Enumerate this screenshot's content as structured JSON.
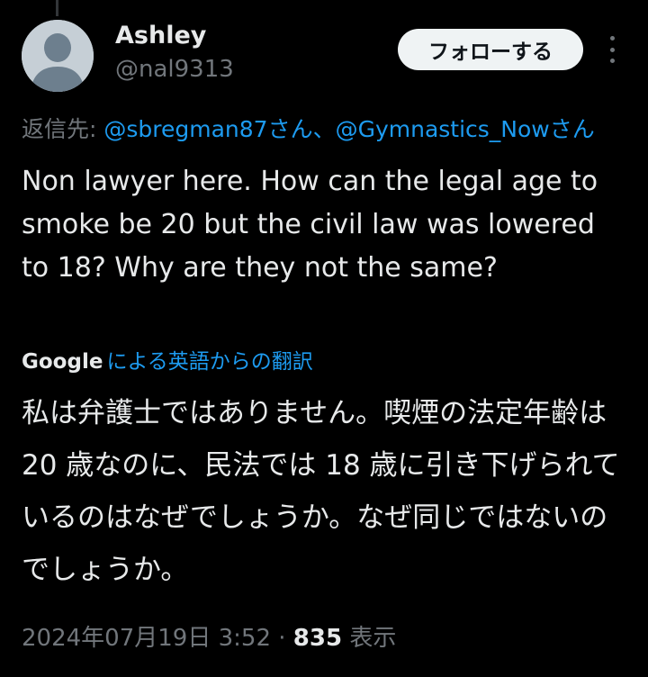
{
  "user": {
    "display_name": "Ashley",
    "handle": "@nal9313"
  },
  "follow_button": {
    "label": "フォローする"
  },
  "reply_to": {
    "prefix": "返信先: ",
    "mention_1": "@sbregman87さん、",
    "mention_2": "@Gymnastics_Nowさん"
  },
  "tweet": {
    "text": "Non lawyer here. How can the legal age to smoke be 20 but the civil law was lowered to 18? Why are they not the same?"
  },
  "translation": {
    "provider": "Google",
    "link_text": "による英語からの翻訳",
    "text": "私は弁護士ではありません。喫煙の法定年齢は 20 歳なのに、民法では 18 歳に引き下げられているのはなぜでしょうか。なぜ同じではないのでしょうか。"
  },
  "meta": {
    "timestamp": "2024年07月19日 3:52",
    "separator": " · ",
    "views_count": "835",
    "views_label": " 表示"
  },
  "icons": {
    "avatar": "default-user-icon",
    "more": "more-vertical-icon"
  },
  "colors": {
    "background": "#000000",
    "text": "#e7e9ea",
    "secondary": "#71767b",
    "link": "#1d9bf0",
    "button_bg": "#eff3f4"
  }
}
